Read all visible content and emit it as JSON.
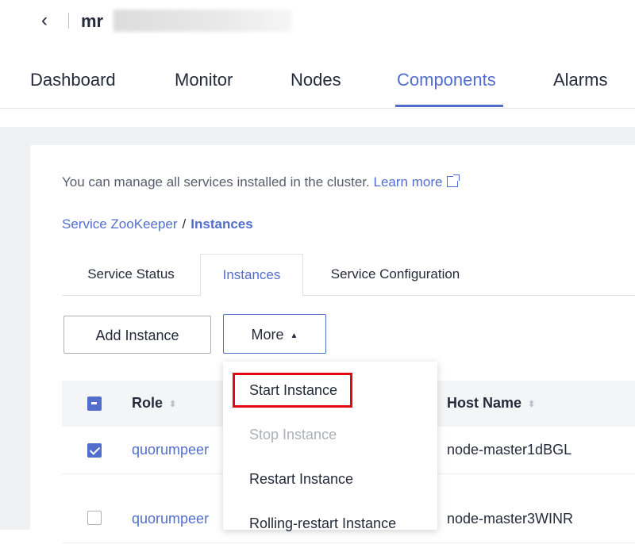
{
  "header": {
    "back_glyph": "‹",
    "cluster_name": "mr"
  },
  "nav": {
    "tabs": [
      "Dashboard",
      "Monitor",
      "Nodes",
      "Components",
      "Alarms"
    ],
    "active": "Components"
  },
  "intro": {
    "text": "You can manage all services installed in the cluster. ",
    "link": "Learn more"
  },
  "breadcrumb": {
    "parent": "Service ZooKeeper",
    "separator": "/",
    "current": "Instances"
  },
  "subtabs": {
    "items": [
      "Service Status",
      "Instances",
      "Service Configuration"
    ],
    "active": "Instances"
  },
  "toolbar": {
    "add_label": "Add Instance",
    "more_label": "More",
    "more_caret": "▲"
  },
  "table": {
    "columns": {
      "role": "Role",
      "host": "Host Name"
    },
    "sort_glyph": "⬍",
    "rows": [
      {
        "role": "quorumpeer",
        "host": "node-master1dBGL",
        "checked": true
      },
      {
        "role": "quorumpeer",
        "host": "node-master3WINR",
        "checked": false
      }
    ]
  },
  "dropdown": {
    "items": [
      {
        "label": "Start Instance",
        "disabled": false,
        "highlighted": true
      },
      {
        "label": "Stop Instance",
        "disabled": true
      },
      {
        "label": "Restart Instance",
        "disabled": false
      },
      {
        "label": "Rolling-restart Instance",
        "disabled": false
      }
    ]
  },
  "colors": {
    "accent": "#526ecc",
    "highlight_border": "#e4090f",
    "disabled_text": "#adb0b8"
  }
}
